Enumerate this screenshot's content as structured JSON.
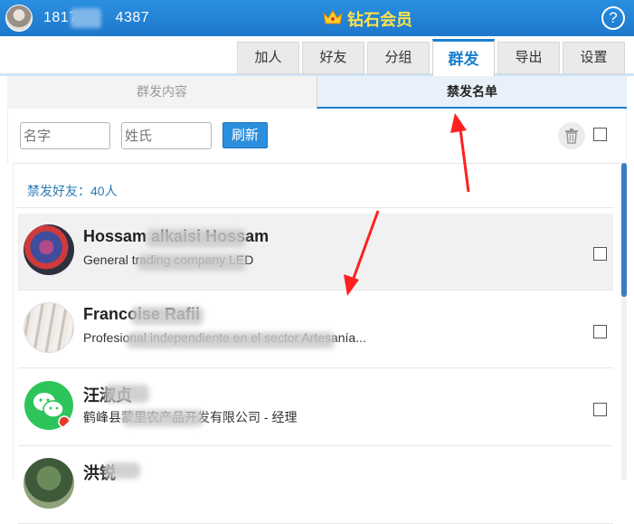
{
  "header": {
    "phone_prefix": "1817",
    "phone_suffix": "4387",
    "title": "钻石会员",
    "help_label": "?"
  },
  "menu": {
    "tabs": [
      {
        "label": "加人"
      },
      {
        "label": "好友"
      },
      {
        "label": "分组"
      },
      {
        "label": "群发"
      },
      {
        "label": "导出"
      },
      {
        "label": "设置"
      }
    ],
    "active_tab": "群发"
  },
  "subtabs": {
    "left": "群发内容",
    "right": "禁发名单",
    "active": "禁发名单"
  },
  "filter": {
    "name_placeholder": "名字",
    "surname_placeholder": "姓氏",
    "refresh_label": "刷新"
  },
  "list": {
    "count_label": "禁发好友：40人",
    "items": [
      {
        "name": "Hossam alkaisi Hossam",
        "desc": "General trading company LED"
      },
      {
        "name": "Francoise Rafii",
        "desc": "Profesional independiente en el sector Artesanía..."
      },
      {
        "name": "汪淑贞",
        "desc": "鹤峰县蒙里农产品开发有限公司 - 经理"
      },
      {
        "name": "洪锐",
        "desc": ""
      }
    ]
  },
  "colors": {
    "accent": "#1b7fd0",
    "header_bg": "#2489de",
    "title_gold": "#ffe14a",
    "annotation_arrow": "#ff2020"
  }
}
